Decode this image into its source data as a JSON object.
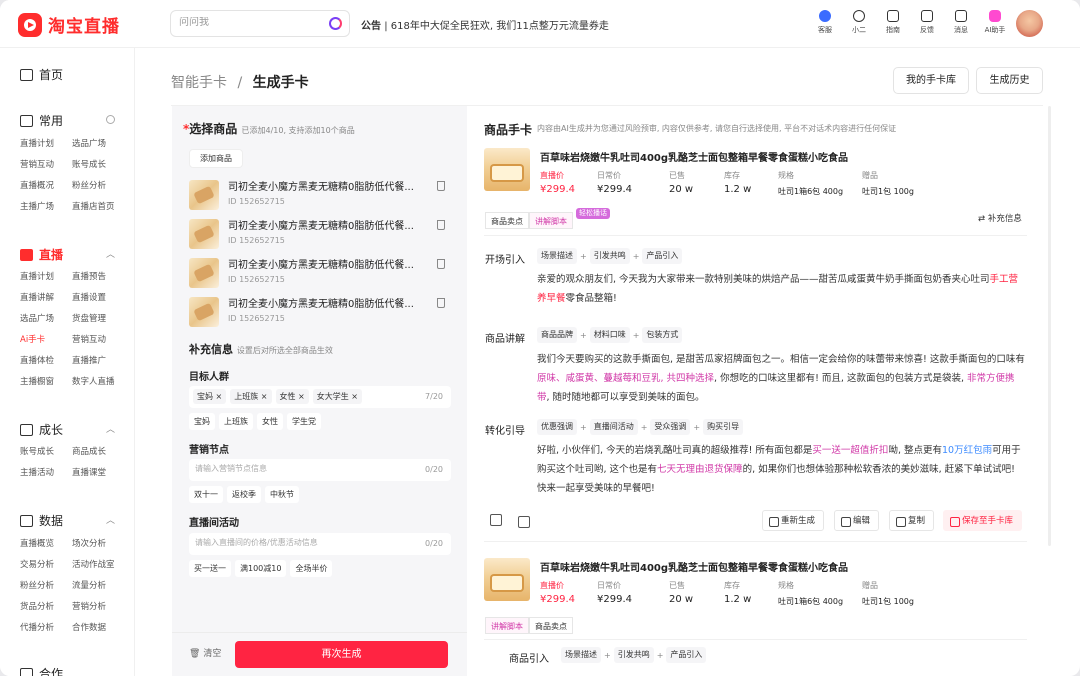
{
  "header": {
    "logo_text": "淘宝直播",
    "search_placeholder": "问问我",
    "notice_label": "公告",
    "notice_text": "618年中大促全民狂欢, 我们11点整万元流量券走",
    "icons": [
      {
        "label": "客服",
        "icon": "service-icon"
      },
      {
        "label": "小二",
        "icon": "person-icon"
      },
      {
        "label": "指南",
        "icon": "guide-icon"
      },
      {
        "label": "反馈",
        "icon": "feedback-icon"
      },
      {
        "label": "消息",
        "icon": "message-icon"
      },
      {
        "label": "AI助手",
        "icon": "ai-assistant-icon"
      }
    ]
  },
  "sidebar": {
    "home": "首页",
    "sections": [
      {
        "title": "常用",
        "items": [
          "直播计划",
          "选品广场",
          "营销互动",
          "账号成长",
          "直播概况",
          "粉丝分析",
          "主播广场",
          "直播店首页"
        ]
      },
      {
        "title": "直播",
        "items": [
          "直播计划",
          "直播预告",
          "直播讲解",
          "直播设置",
          "选品广场",
          "货盘管理",
          "Ai手卡",
          "营销互动",
          "直播体检",
          "直播推广",
          "主播橱窗",
          "数字人直播"
        ],
        "active_item": "Ai手卡"
      },
      {
        "title": "成长",
        "items": [
          "账号成长",
          "商品成长",
          "主播活动",
          "直播课堂"
        ]
      },
      {
        "title": "数据",
        "items": [
          "直播概览",
          "场次分析",
          "交易分析",
          "活动作战室",
          "粉丝分析",
          "流量分析",
          "货品分析",
          "营销分析",
          "代播分析",
          "合作数据"
        ]
      },
      {
        "title": "合作",
        "items": []
      }
    ]
  },
  "breadcrumb": {
    "parent": "智能手卡",
    "sep": "/",
    "current": "生成手卡"
  },
  "top_buttons": {
    "my_cards": "我的手卡库",
    "history": "生成历史"
  },
  "left_panel": {
    "required_mark": "*",
    "title": "选择商品",
    "subtitle": "已添加4/10, 支持添加10个商品",
    "add_button": "添加商品",
    "products": [
      {
        "name": "司初全麦小魔方黑麦无糖精0脂肪低代餐...",
        "id": "ID 152652715"
      },
      {
        "name": "司初全麦小魔方黑麦无糖精0脂肪低代餐...",
        "id": "ID 152652715"
      },
      {
        "name": "司初全麦小魔方黑麦无糖精0脂肪低代餐...",
        "id": "ID 152652715"
      },
      {
        "name": "司初全麦小魔方黑麦无糖精0脂肪低代餐...",
        "id": "ID 152652715"
      }
    ],
    "supplement_title": "补充信息",
    "supplement_sub": "设置后对所选全部商品生效",
    "audience_label": "目标人群",
    "audience_tags": [
      "宝妈",
      "上班族",
      "女性",
      "女大学生"
    ],
    "audience_count": "7/20",
    "audience_chips": [
      "宝妈",
      "上班族",
      "女性",
      "学生党"
    ],
    "marketing_label": "营销节点",
    "marketing_placeholder": "请输入营销节点信息",
    "marketing_count": "0/20",
    "marketing_chips": [
      "双十一",
      "返校季",
      "中秋节"
    ],
    "activity_label": "直播间活动",
    "activity_placeholder": "请输入直播间的价格/优惠活动信息",
    "activity_count": "0/20",
    "activity_chips": [
      "买一送一",
      "满100减10",
      "全场半价"
    ],
    "clear_label": "清空",
    "regenerate_label": "再次生成"
  },
  "right_panel": {
    "title": "商品手卡",
    "subtitle": "内容由AI生成并为您通过风险预审, 内容仅供参考, 请您自行选择使用, 平台不对话术内容进行任何保证",
    "cards": [
      {
        "thumb_caption": "岩烧乳酪吐司400g",
        "name": "百草味岩烧嫩牛乳吐司400g乳酪芝士面包整箱早餐零食蛋糕小吃食品",
        "stats": [
          {
            "label": "直播价",
            "value": "¥299.4"
          },
          {
            "label": "日常价",
            "value": "¥299.4"
          },
          {
            "label": "已售",
            "value": "20 w"
          },
          {
            "label": "库存",
            "value": "1.2 w"
          },
          {
            "label": "规格",
            "value": "吐司1箱6包 400g"
          },
          {
            "label": "赠品",
            "value": "吐司1包 100g"
          }
        ],
        "tabs": [
          "商品卖点",
          "讲解脚本"
        ],
        "tab_badge": "轻松播话",
        "supplement_button": "补充信息",
        "blocks": [
          {
            "title": "开场引入",
            "tags": [
              "场景描述",
              "引发共鸣",
              "产品引入"
            ],
            "segments": [
              [
                "n",
                "亲爱的观众朋友们, 今天我为大家带来一款特别美味的烘焙产品——甜苦瓜咸蛋黄牛奶手撕面包奶香夹心吐司"
              ],
              [
                "r",
                "手工营养早餐"
              ],
              [
                "n",
                "零食品整箱!"
              ]
            ]
          },
          {
            "title": "商品讲解",
            "tags": [
              "商品品牌",
              "材料口味",
              "包装方式"
            ],
            "segments": [
              [
                "n",
                "我们今天要购买的这款手撕面包, 是甜苦瓜家招牌面包之一。相信一定会给你的味蕾带来惊喜! 这款手撕面包的口味有"
              ],
              [
                "p",
                "原味、咸蛋黄、蔓越莓和豆乳, 共四种选择"
              ],
              [
                "n",
                ", 你想吃的口味这里都有! 而且, 这款面包的包装方式是袋装, "
              ],
              [
                "p",
                "非常方便携带"
              ],
              [
                "n",
                ", 随时随地都可以享受到美味的面包。"
              ]
            ]
          },
          {
            "title": "转化引导",
            "tags": [
              "优惠强调",
              "直播间活动",
              "受众强调",
              "购买引导"
            ],
            "segments": [
              [
                "n",
                "好啦, 小伙伴们, 今天的岩烧乳酪吐司真的超级推荐! 所有面包都是"
              ],
              [
                "p",
                "买一送一超值折扣"
              ],
              [
                "n",
                "呦, 整点更有"
              ],
              [
                "b",
                "10万红包雨"
              ],
              [
                "n",
                "可用于购买这个吐司哟, 这个也是有"
              ],
              [
                "p",
                "七天无理由退货保障"
              ],
              [
                "n",
                "的, 如果你们也想体验那种松软香浓的美妙滋味, 赶紧下单试试吧! 快来一起享受美味的早餐吧!"
              ]
            ]
          }
        ],
        "actions": [
          "重新生成",
          "编辑",
          "复制",
          "保存至手卡库"
        ]
      },
      {
        "thumb_caption": "岩烧乳酪吐司400g",
        "name": "百草味岩烧嫩牛乳吐司400g乳酪芝士面包整箱早餐零食蛋糕小吃食品",
        "stats": [
          {
            "label": "直播价",
            "value": "¥299.4"
          },
          {
            "label": "日常价",
            "value": "¥299.4"
          },
          {
            "label": "已售",
            "value": "20 w"
          },
          {
            "label": "库存",
            "value": "1.2 w"
          },
          {
            "label": "规格",
            "value": "吐司1箱6包 400g"
          },
          {
            "label": "赠品",
            "value": "吐司1包 100g"
          }
        ],
        "tabs": [
          "讲解脚本",
          "商品卖点"
        ],
        "blocks": [
          {
            "title": "商品引入",
            "tags": [
              "场景描述",
              "引发共鸣",
              "产品引入"
            ]
          }
        ]
      }
    ]
  },
  "colors": {
    "brand_red": "#ff2442",
    "highlight_pink": "#d13aa8",
    "highlight_blue": "#3d8bff"
  }
}
